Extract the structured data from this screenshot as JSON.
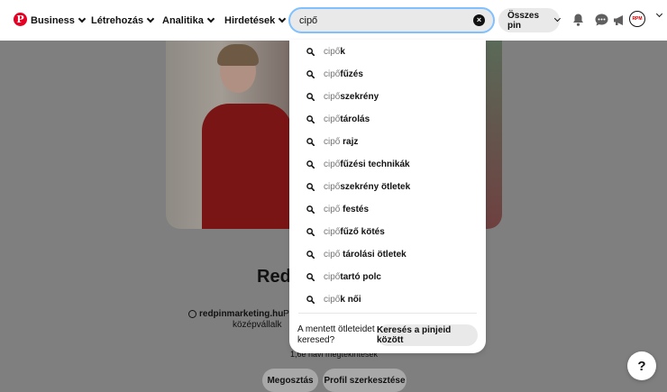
{
  "header": {
    "nav": [
      {
        "label": "Business"
      },
      {
        "label": "Létrehozás"
      },
      {
        "label": "Analitika"
      },
      {
        "label": "Hirdetések"
      }
    ],
    "search": {
      "value": "cipő",
      "placeholder": ""
    },
    "scope_label": "Összes pin",
    "icons": [
      "bell-icon",
      "messages-icon",
      "megaphone-icon"
    ],
    "avatar_text": "RPM",
    "accent_color": "#e60023"
  },
  "suggestions": {
    "query": "cipő",
    "items": [
      {
        "query": "cipő",
        "completion": "k"
      },
      {
        "query": "cipő",
        "completion": "fűzés"
      },
      {
        "query": "cipő",
        "completion": "szekrény"
      },
      {
        "query": "cipő",
        "completion": "tárolás"
      },
      {
        "query": "cipő",
        "completion": " rajz"
      },
      {
        "query": "cipő",
        "completion": "fűzési technikák"
      },
      {
        "query": "cipő",
        "completion": "szekrény ötletek"
      },
      {
        "query": "cipő",
        "completion": " festés"
      },
      {
        "query": "cipő",
        "completion": "fűző kötés"
      },
      {
        "query": "cipő",
        "completion": " tárolási ötletek"
      },
      {
        "query": "cipő",
        "completion": "tartó polc"
      },
      {
        "query": "cipő",
        "completion": "k női"
      }
    ],
    "saved_question": "A mentett ötleteidet keresed?",
    "saved_button": "Keresés a pinjeid között"
  },
  "profile": {
    "name_fragment": "Red",
    "website": "redpinmarketing.hu",
    "desc_fragment_1": "· Pin",
    "desc_fragment_2": "középvállalk",
    "monthly_views": "1,6e havi megtekintések",
    "share_label": "Megosztás",
    "edit_label": "Profil szerkesztése"
  },
  "help_label": "?"
}
